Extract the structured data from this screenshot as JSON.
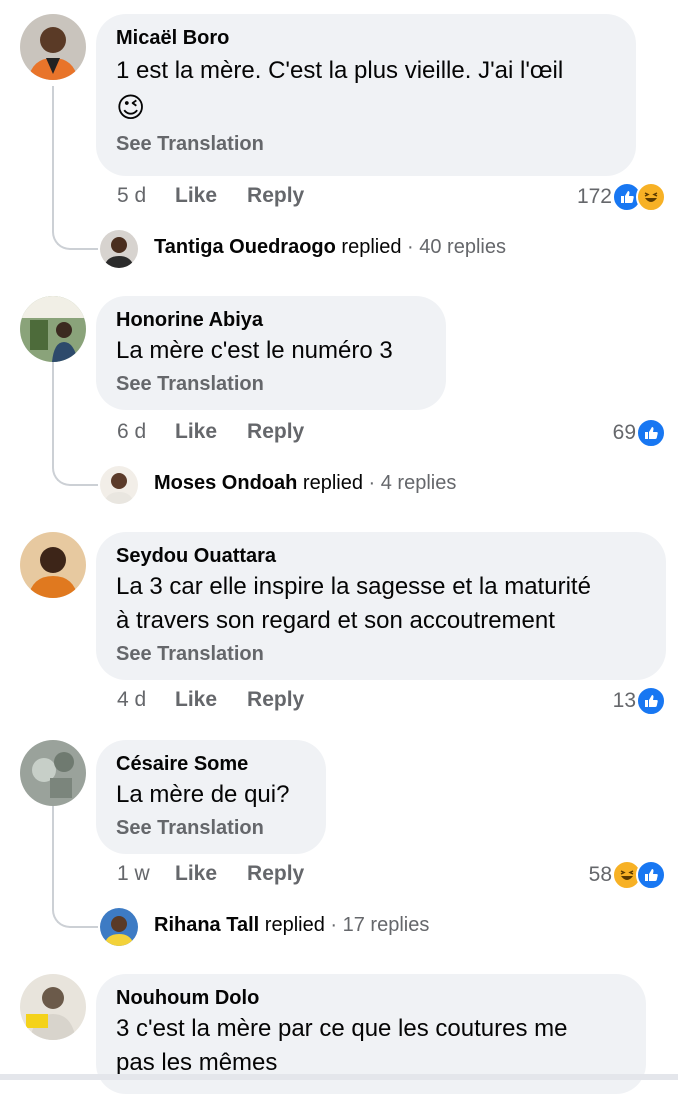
{
  "comments": [
    {
      "author": "Micaël Boro",
      "text": "1 est la mère. C'est la plus vieille. J'ai l'œil",
      "emoji": "😉",
      "see_translation": "See Translation",
      "time": "5 d",
      "like": "Like",
      "reply": "Reply",
      "reaction_count": "172",
      "reactions": [
        "like",
        "haha"
      ],
      "replied": {
        "name": "Tantiga Ouedraogo",
        "text": "replied",
        "count": "· 40 replies"
      }
    },
    {
      "author": "Honorine Abiya",
      "text": "La mère c'est le numéro 3",
      "see_translation": "See Translation",
      "time": "6 d",
      "like": "Like",
      "reply": "Reply",
      "reaction_count": "69",
      "reactions": [
        "like"
      ],
      "replied": {
        "name": "Moses Ondoah",
        "text": "replied",
        "count": "· 4 replies"
      }
    },
    {
      "author": "Seydou Ouattara",
      "text_line1": "La 3 car elle inspire la sagesse et la maturité",
      "text_line2": "à travers son regard et son accoutrement",
      "see_translation": "See Translation",
      "time": "4 d",
      "like": "Like",
      "reply": "Reply",
      "reaction_count": "13",
      "reactions": [
        "like"
      ]
    },
    {
      "author": "Césaire Some",
      "text": "La mère de qui?",
      "see_translation": "See Translation",
      "time": "1 w",
      "like": "Like",
      "reply": "Reply",
      "reaction_count": "58",
      "reactions": [
        "haha",
        "like"
      ],
      "replied": {
        "name": "Rihana Tall",
        "text": "replied",
        "count": "· 17 replies"
      }
    },
    {
      "author": "Nouhoum Dolo",
      "text_line1": "3 c'est la mère par ce que les coutures me",
      "text_line2": "pas les mêmes"
    }
  ],
  "colors": {
    "bubble": "#f0f2f5",
    "muted": "#65676b",
    "like_blue": "#1877f2",
    "haha_yellow": "#f7b125"
  }
}
